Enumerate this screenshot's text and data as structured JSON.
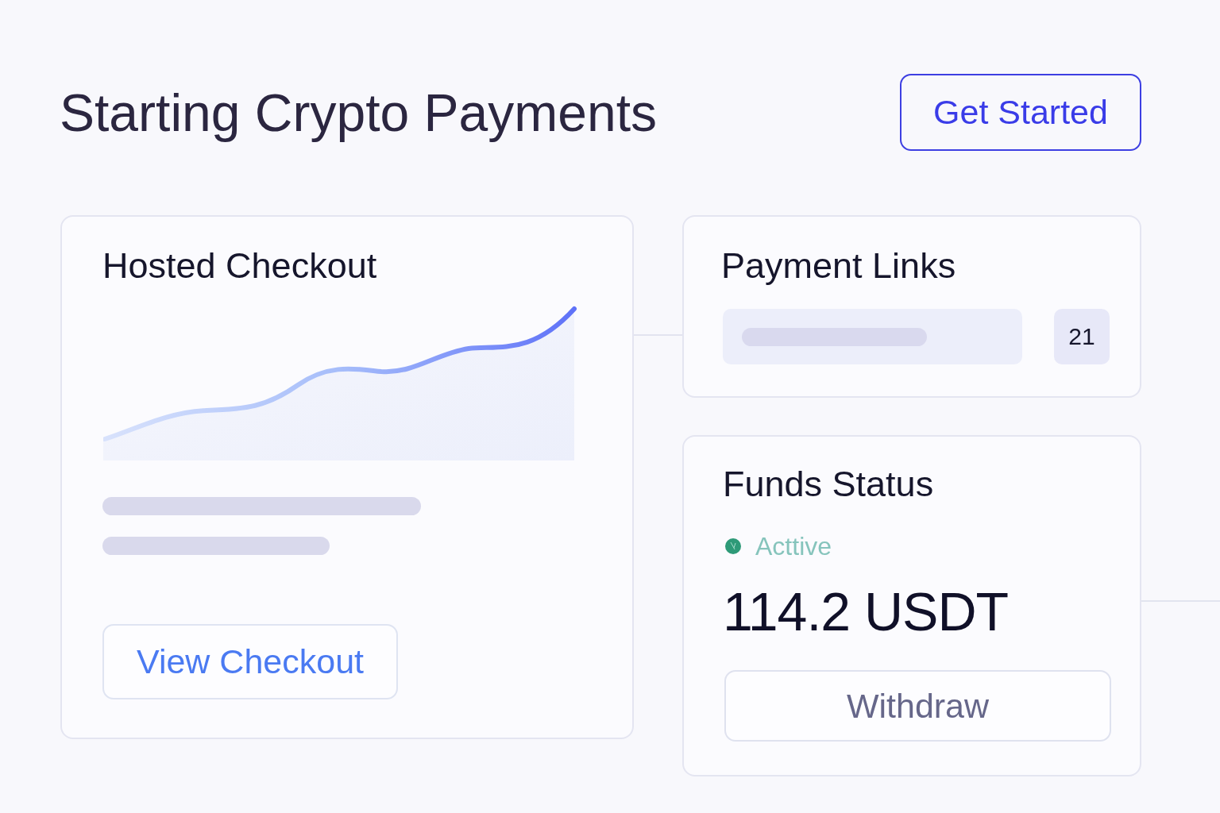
{
  "header": {
    "title": "Starting Crypto Payments",
    "button": "Get Started"
  },
  "hosted_checkout": {
    "title": "Hosted Checkout",
    "button": "View Checkout"
  },
  "payment_links": {
    "title": "Payment Links",
    "count": "21"
  },
  "funds_status": {
    "title": "Funds Status",
    "status": "Acttive",
    "amount": "114.2 USDT",
    "button": "Withdraw"
  }
}
